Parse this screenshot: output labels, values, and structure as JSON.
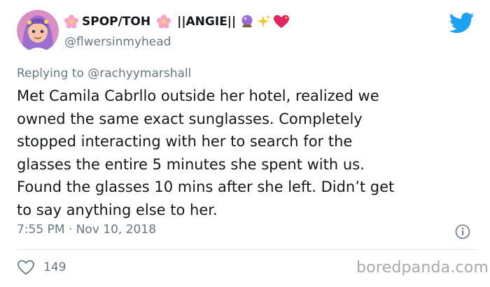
{
  "author": {
    "name_segments": [
      "SPOP/TOH",
      "||ANGIE||"
    ],
    "handle": "@flwersinmyhead",
    "avatar_icon": "cartoon-girl-avatar",
    "name_emojis": [
      "cherry-blossom-icon",
      "cherry-blossom-icon",
      "crystal-ball-icon",
      "sparkles-icon",
      "sparkling-heart-icon"
    ]
  },
  "reply": {
    "prefix": "Replying to",
    "mention": "@rachyymarshall"
  },
  "tweet": {
    "lines": [
      "Met Camila Cabrllo outside her hotel, realized we",
      "owned the same exact sunglasses. Completely",
      "stopped interacting with her to search for the",
      "glasses the entire 5 minutes she spent with us.",
      "Found the glasses 10 mins after she left. Didn’t get",
      "to say anything else to her."
    ]
  },
  "meta": {
    "time": "7:55 PM",
    "separator": "·",
    "date": "Nov 10, 2018"
  },
  "actions": {
    "like_count": "149"
  },
  "watermark": "boredpanda.com",
  "colors": {
    "text": "#14171a",
    "secondary": "#657786",
    "twitter_blue": "#1da1f2",
    "divider": "#e1e8ed",
    "watermark": "#a9a9a9"
  }
}
